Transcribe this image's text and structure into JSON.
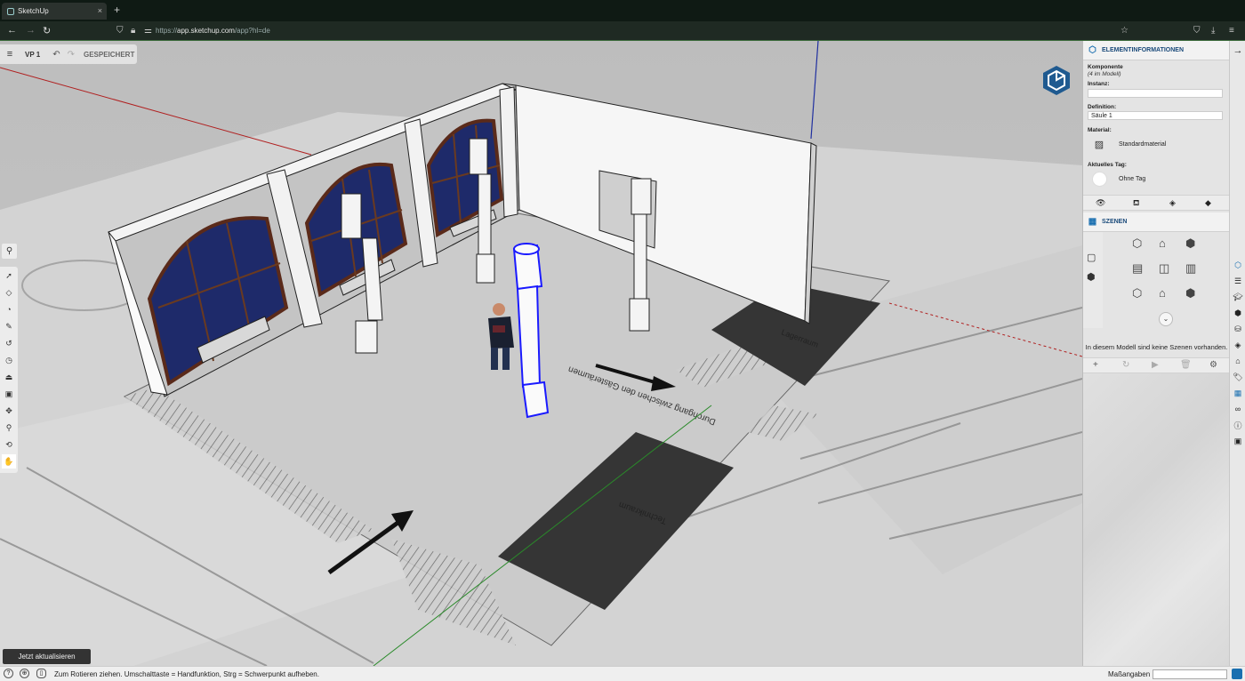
{
  "browser": {
    "tab_title": "SketchUp",
    "tab_close": "×",
    "new_tab": "+",
    "url_prefix": "https://",
    "url_host": "app.sketchup.com",
    "url_path": "/app?hl=de"
  },
  "topbar": {
    "menu_icon": "≡",
    "model_name": "VP 1",
    "undo_icon": "↶",
    "redo_icon": "↷",
    "save_status": "GESPEICHERT"
  },
  "toolbar": {
    "search_icon": "⚲",
    "tools": [
      "select-tool",
      "eraser-tool",
      "paint-tool",
      "line-tool",
      "arc-tool",
      "rectangle-tool",
      "push-pull-tool",
      "offset-tool",
      "move-tool",
      "tape-measure-tool",
      "orbit-tool",
      "pan-tool"
    ]
  },
  "update_button": "Jetzt aktualisieren",
  "entity_info": {
    "header": "ELEMENTINFORMATIONEN",
    "type": "Komponente",
    "count": "(4 im Modell)",
    "instance_label": "Instanz:",
    "instance_value": "",
    "definition_label": "Definition:",
    "definition_value": "Säule 1",
    "material_label": "Material:",
    "material_value": "Standardmaterial",
    "tag_label": "Aktuelles Tag:",
    "tag_value": "Ohne Tag"
  },
  "scenes": {
    "header": "SZENEN",
    "empty_message": "In diesem Modell sind keine Szenen vorhanden."
  },
  "status": {
    "message": "Zum Rotieren ziehen. Umschalttaste = Handfunktion, Strg = Schwerpunkt aufheben.",
    "measurements_label": "Maßangaben",
    "measurements_value": ""
  },
  "colors": {
    "accent": "#1a6fb0",
    "selection": "#1a1aff",
    "dark_floor": "#3a3a3a"
  }
}
